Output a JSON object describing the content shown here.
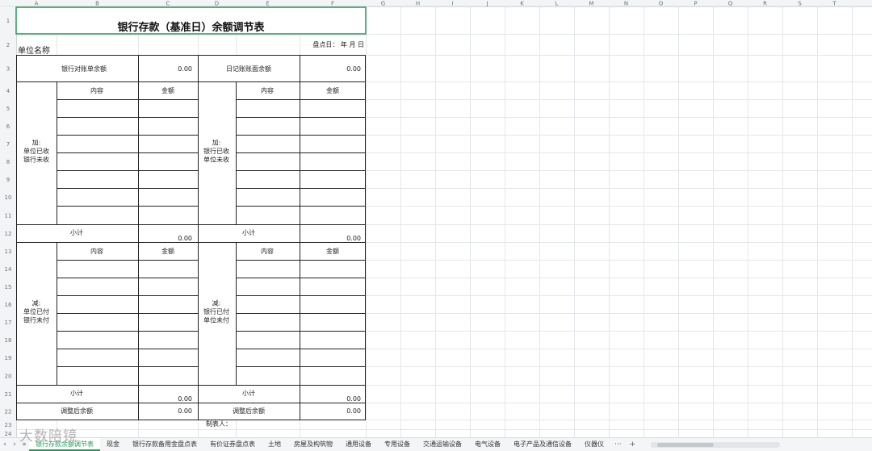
{
  "column_letters": [
    "A",
    "B",
    "C",
    "D",
    "E",
    "F",
    "G",
    "H",
    "I",
    "J",
    "K",
    "L",
    "M",
    "N",
    "O",
    "P",
    "Q",
    "R",
    "S",
    "T"
  ],
  "row_numbers": [
    "1",
    "2",
    "3",
    "4",
    "5",
    "6",
    "7",
    "8",
    "9",
    "10",
    "11",
    "12",
    "13",
    "14",
    "15",
    "16",
    "17",
    "18",
    "19",
    "20",
    "21",
    "22",
    "23",
    "24"
  ],
  "sheet": {
    "title": "银行存款（基准日）余额调节表",
    "unit_label": "单位名称",
    "date_label": "盘点日：  年  月  日",
    "bank_balance_label": "银行对账单余额",
    "bank_balance_value": "0.00",
    "ledger_balance_label": "日记账账面余额",
    "ledger_balance_value": "0.00",
    "content_header": "内容",
    "amount_header": "金额",
    "add_left": [
      "加:",
      "单位已收",
      "银行未收"
    ],
    "add_right": [
      "加:",
      "银行已收",
      "单位未收"
    ],
    "less_left": [
      "减:",
      "单位已付",
      "银行未付"
    ],
    "less_right": [
      "减:",
      "银行已付",
      "单位未付"
    ],
    "subtotal_label": "小计",
    "subtotal_value": "0.00",
    "adjusted_label": "调整后余额",
    "adjusted_value": "0.00",
    "preparer_label": "制表人："
  },
  "tabs": [
    "银行存款余额调节表",
    "现金",
    "银行存款备用金盘点表",
    "有价证券盘点表",
    "土地",
    "房屋及构筑物",
    "通用设备",
    "专用设备",
    "交通运输设备",
    "电气设备",
    "电子产品及通信设备",
    "仪器仪"
  ],
  "tab_more": "···",
  "tab_add": "+",
  "watermark": "大数陪镜",
  "colors": {
    "accent": "#1f9d55",
    "grid": "#e3e6ea",
    "border": "#222222"
  }
}
